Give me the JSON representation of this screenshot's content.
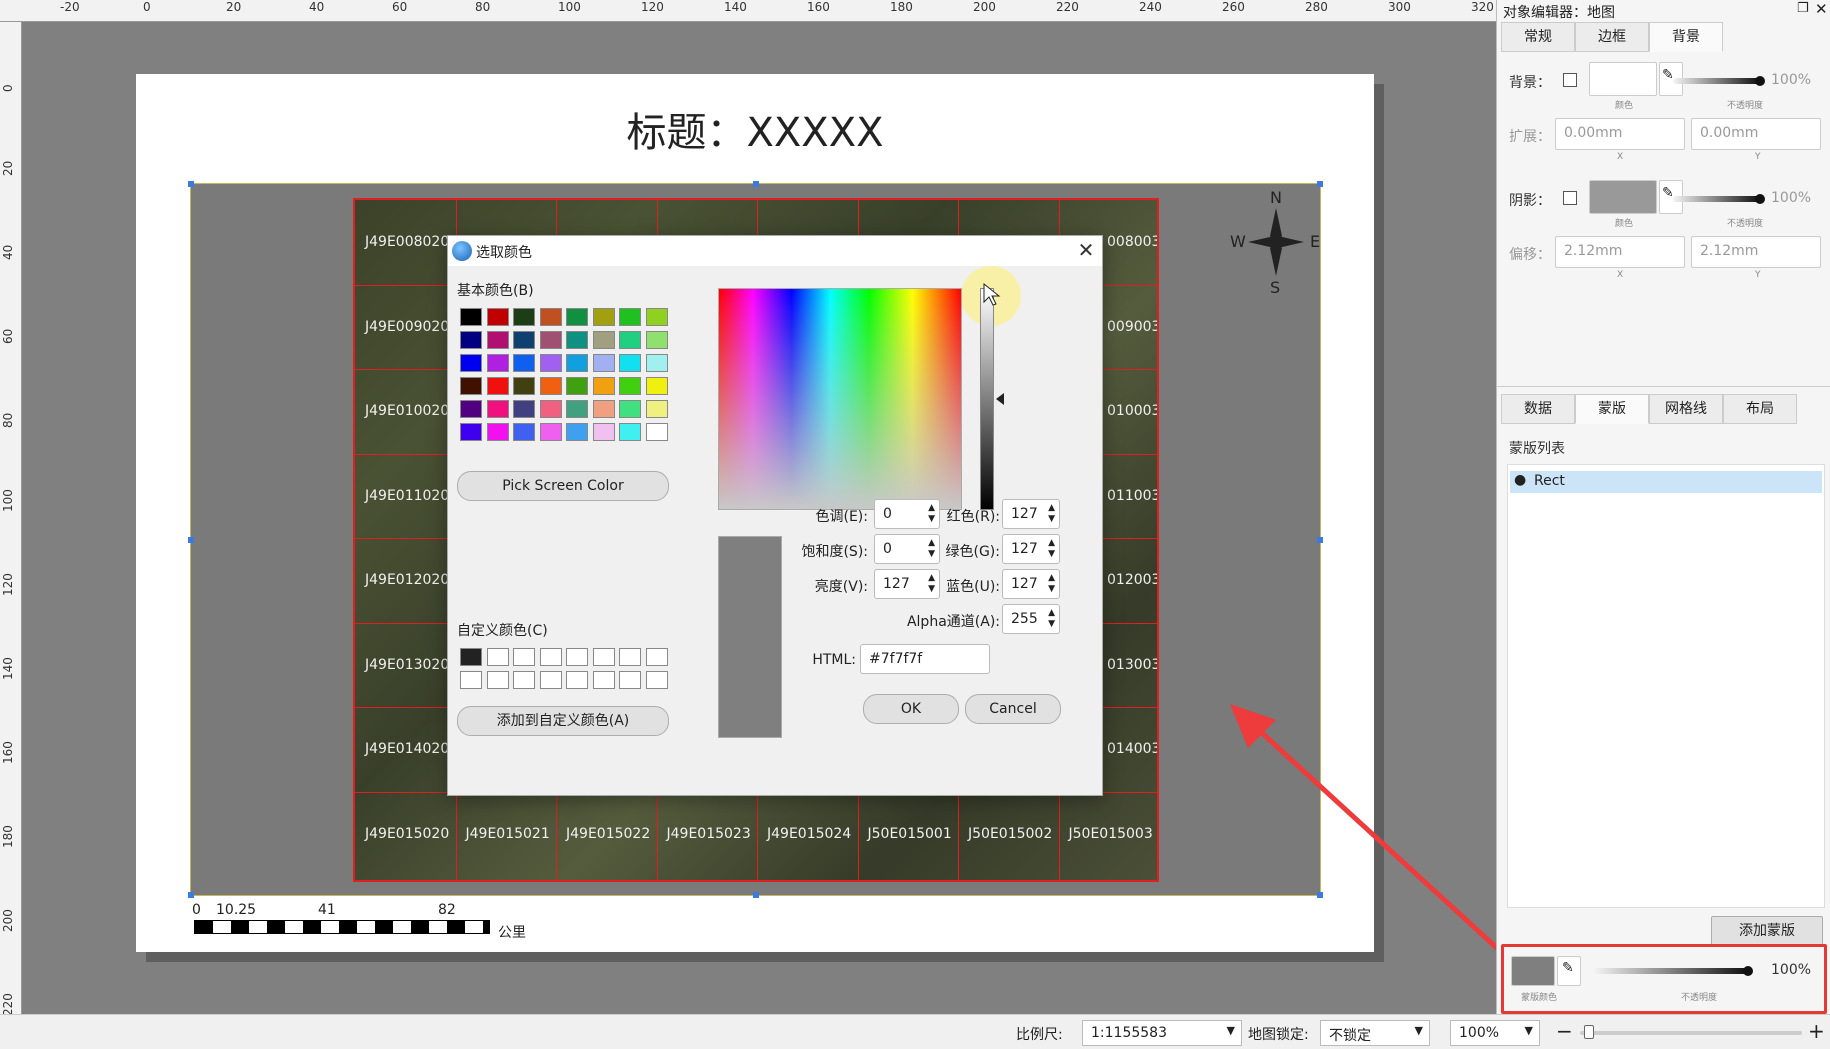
{
  "ruler": {
    "top_labels": [
      "-20",
      "0",
      "20",
      "40",
      "60",
      "80",
      "100",
      "120",
      "140",
      "160",
      "180",
      "200",
      "220",
      "240",
      "260",
      "280",
      "300",
      "320"
    ],
    "left_labels": [
      "0",
      "20",
      "40",
      "60",
      "80",
      "100",
      "120",
      "140",
      "160",
      "180",
      "200",
      "220"
    ]
  },
  "map": {
    "title": "标题：XXXXX",
    "tiles_left": [
      "J49E008020",
      "J49E009020",
      "J49E010020",
      "J49E011020",
      "J49E012020",
      "J49E013020",
      "J49E014020"
    ],
    "tiles_right": [
      "008003",
      "009003",
      "010003",
      "011003",
      "012003",
      "013003",
      "014003"
    ],
    "tiles_bottom": [
      "J49E015020",
      "J49E015021",
      "J49E015022",
      "J49E015023",
      "J49E015024",
      "J50E015001",
      "J50E015002",
      "J50E015003"
    ],
    "compass": {
      "n": "N",
      "s": "S",
      "e": "E",
      "w": "W"
    },
    "scalebar": {
      "labels": [
        "0",
        "10.25",
        "41",
        "82"
      ],
      "unit": "公里"
    }
  },
  "dialog": {
    "title": "选取颜色",
    "close": "✕",
    "basic_colors_label": "基本颜色(B)",
    "basic_colors": [
      "#000000",
      "#c00000",
      "#1c3d16",
      "#c05020",
      "#109040",
      "#a0a010",
      "#20c020",
      "#90d020",
      "#000080",
      "#b01070",
      "#104070",
      "#a05070",
      "#109080",
      "#a0a080",
      "#20d080",
      "#90e070",
      "#0000f0",
      "#b020e0",
      "#1060f0",
      "#a060f0",
      "#10a0e0",
      "#a0b0f0",
      "#10e0f0",
      "#a0f0f0",
      "#401000",
      "#f01010",
      "#404010",
      "#f06010",
      "#40a010",
      "#f0a010",
      "#40d010",
      "#f0f010",
      "#500080",
      "#f01080",
      "#404080",
      "#f06080",
      "#40a080",
      "#f0a080",
      "#40e080",
      "#f0f080",
      "#4000f0",
      "#f010f0",
      "#4060f0",
      "#f060f0",
      "#40a0f0",
      "#f0c0f0",
      "#40f0f0",
      "#ffffff"
    ],
    "pick_screen_color": "Pick Screen Color",
    "custom_colors_label": "自定义颜色(C)",
    "custom_colors": [
      "#222222",
      "#ffffff",
      "#ffffff",
      "#ffffff",
      "#ffffff",
      "#ffffff",
      "#ffffff",
      "#ffffff",
      "#ffffff",
      "#ffffff",
      "#ffffff",
      "#ffffff",
      "#ffffff",
      "#ffffff",
      "#ffffff",
      "#ffffff"
    ],
    "add_custom": "添加到自定义颜色(A)",
    "fields": {
      "hue_label": "色调(E):",
      "hue": "0",
      "sat_label": "饱和度(S):",
      "sat": "0",
      "val_label": "亮度(V):",
      "val": "127",
      "red_label": "红色(R):",
      "red": "127",
      "green_label": "绿色(G):",
      "green": "127",
      "blue_label": "蓝色(U):",
      "blue": "127",
      "alpha_label": "Alpha通道(A):",
      "alpha": "255",
      "html_label": "HTML:",
      "html": "#7f7f7f"
    },
    "ok": "OK",
    "cancel": "Cancel",
    "preview_color": "#7f7f7f"
  },
  "panel": {
    "title": "对象编辑器：地图",
    "tabs_top": [
      "常规",
      "边框",
      "背景"
    ],
    "active_top": "背景",
    "bg_label": "背景：",
    "color_sub": "颜色",
    "opacity_sub": "不透明度",
    "bg_opacity": "100%",
    "expand_label": "扩展：",
    "expand_x": "0.00mm",
    "expand_y": "0.00mm",
    "x_sub": "X",
    "y_sub": "Y",
    "shadow_label": "阴影：",
    "shadow_opacity": "100%",
    "offset_label": "偏移：",
    "offset_x": "2.12mm",
    "offset_y": "2.12mm",
    "tabs_mid": [
      "数据",
      "蒙版",
      "网格线",
      "布局"
    ],
    "active_mid": "蒙版",
    "mask_list_label": "蒙版列表",
    "mask_item": "Rect",
    "add_mask": "添加蒙版",
    "mask_color_sub": "蒙版颜色",
    "mask_opacity": "100%",
    "mask_opacity_sub": "不透明度"
  },
  "status": {
    "scale_label": "比例尺:",
    "scale_value": "1:1155583",
    "lock_label": "地图锁定:",
    "lock_value": "不锁定",
    "zoom": "100%"
  }
}
